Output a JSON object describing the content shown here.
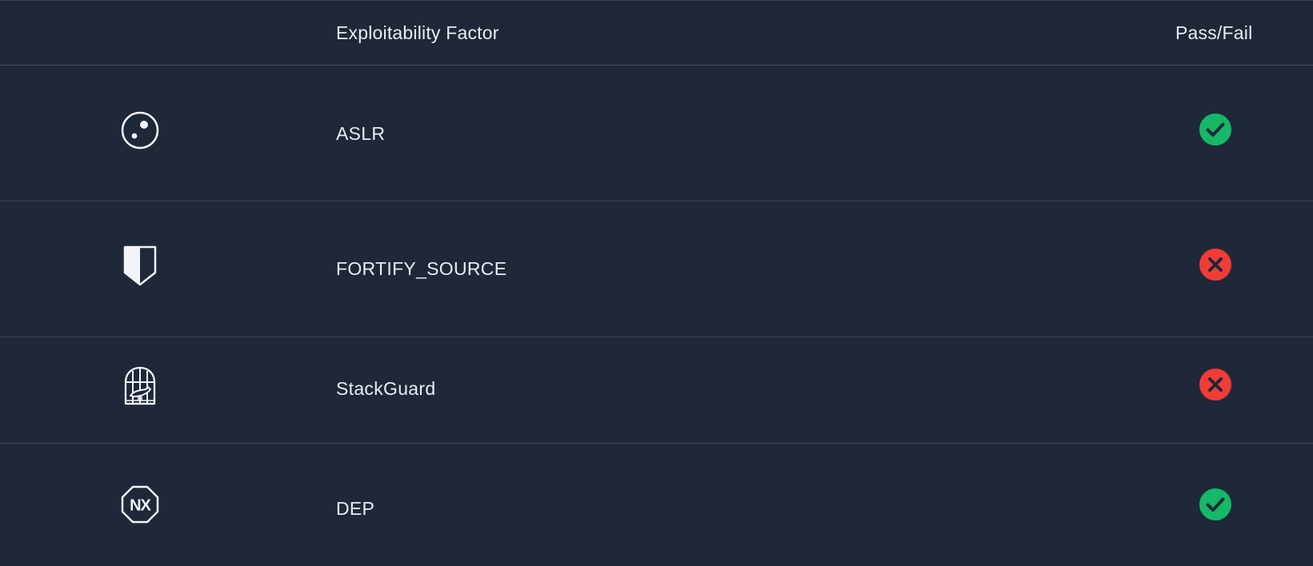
{
  "header": {
    "factor_label": "Exploitability Factor",
    "status_label": "Pass/Fail"
  },
  "rows": [
    {
      "label": "ASLR",
      "icon": "aslr-dots-icon",
      "status": "pass"
    },
    {
      "label": "FORTIFY_SOURCE",
      "icon": "shield-icon",
      "status": "fail"
    },
    {
      "label": "StackGuard",
      "icon": "birdcage-icon",
      "status": "fail"
    },
    {
      "label": "DEP",
      "icon": "nx-octagon-icon",
      "nx_text": "NX",
      "status": "pass"
    }
  ],
  "colors": {
    "background": "#1f2839",
    "pass": "#15b866",
    "fail": "#f03c35",
    "text": "#e9edf3",
    "divider": "#3a4456"
  }
}
